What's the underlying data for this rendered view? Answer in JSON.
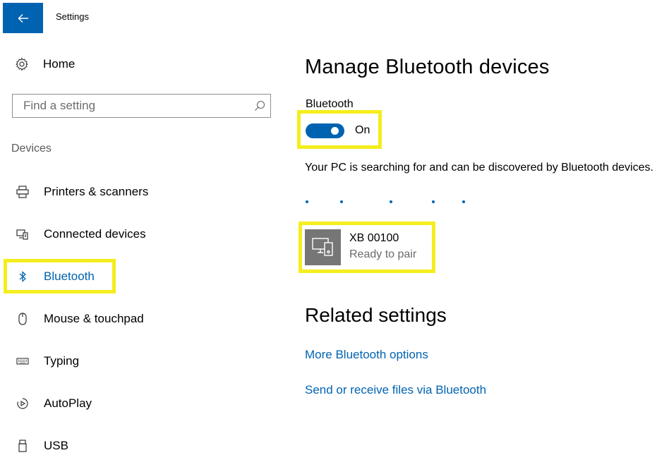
{
  "titlebar": {
    "title": "Settings",
    "back_icon": "back-arrow-icon",
    "accent": "#0063b1"
  },
  "sidebar": {
    "home_label": "Home",
    "search_placeholder": "Find a setting",
    "category": "Devices",
    "items": [
      {
        "label": "Printers & scanners",
        "icon": "printer-icon",
        "active": false
      },
      {
        "label": "Connected devices",
        "icon": "connected-devices-icon",
        "active": false
      },
      {
        "label": "Bluetooth",
        "icon": "bluetooth-icon",
        "active": true
      },
      {
        "label": "Mouse & touchpad",
        "icon": "mouse-icon",
        "active": false
      },
      {
        "label": "Typing",
        "icon": "keyboard-icon",
        "active": false
      },
      {
        "label": "AutoPlay",
        "icon": "autoplay-icon",
        "active": false
      },
      {
        "label": "USB",
        "icon": "usb-icon",
        "active": false
      }
    ]
  },
  "main": {
    "title": "Manage Bluetooth devices",
    "bluetooth_label": "Bluetooth",
    "toggle_state": "On",
    "status_text": "Your PC is searching for and can be discovered by Bluetooth devices.",
    "device": {
      "name": "XB 00100",
      "status": "Ready to pair",
      "icon": "device-icon"
    },
    "related_title": "Related settings",
    "links": [
      "More Bluetooth options",
      "Send or receive files via Bluetooth"
    ]
  },
  "colors": {
    "accent": "#0063b1",
    "highlight": "#f4ee1d",
    "device_tile": "#767676"
  }
}
